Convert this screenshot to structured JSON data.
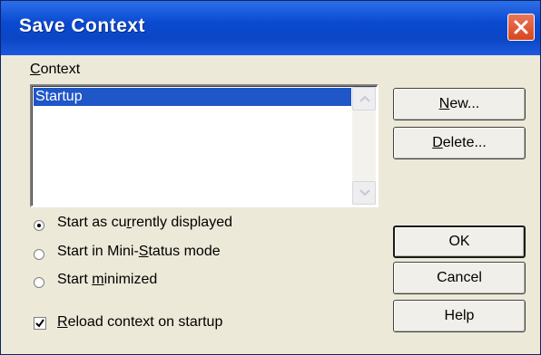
{
  "dialog": {
    "title": "Save Context",
    "close_icon": "close-icon"
  },
  "context": {
    "label_prefix": "",
    "label_mnemonic": "C",
    "label_rest": "ontext",
    "items": [
      "Startup"
    ],
    "selected": "Startup"
  },
  "buttons": {
    "new": {
      "mnemonic": "N",
      "rest": "ew..."
    },
    "delete": {
      "mnemonic": "D",
      "rest": "elete..."
    },
    "ok": "OK",
    "cancel": "Cancel",
    "help": "Help"
  },
  "start_options": [
    {
      "pre": "Start as cu",
      "mnemonic": "r",
      "post": "rently displayed",
      "checked": true
    },
    {
      "pre": "Start in Mini-",
      "mnemonic": "S",
      "post": "tatus mode",
      "checked": false
    },
    {
      "pre": "Start ",
      "mnemonic": "m",
      "post": "inimized",
      "checked": false
    }
  ],
  "reload": {
    "pre": "",
    "mnemonic": "R",
    "post": "eload context on startup",
    "checked": true
  }
}
